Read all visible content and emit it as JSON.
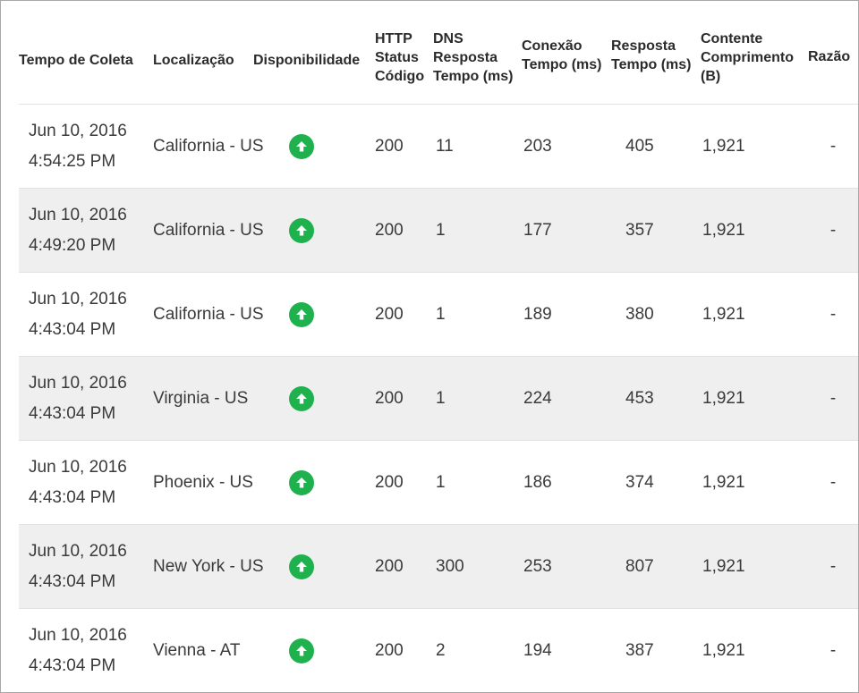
{
  "headers": {
    "collect_time": "Tempo de Coleta",
    "location": "Localização",
    "availability": "Disponibilidade",
    "http_status": [
      "HTTP",
      "Status",
      "Código"
    ],
    "dns_response": [
      "DNS",
      "Resposta",
      "Tempo (ms)"
    ],
    "connection": [
      "Conexão",
      "Tempo (ms)"
    ],
    "response": [
      "Resposta",
      "Tempo (ms)"
    ],
    "content_length": [
      "Contente",
      "Comprimento",
      "(B)"
    ],
    "reason": "Razão"
  },
  "rows": [
    {
      "date": "Jun 10, 2016",
      "time": "4:54:25 PM",
      "location": "California - US",
      "availability_icon": "arrow-up-circle-icon",
      "http": "200",
      "dns": "11",
      "conn": "203",
      "resp": "405",
      "length": "1,921",
      "reason": "-"
    },
    {
      "date": "Jun 10, 2016",
      "time": "4:49:20 PM",
      "location": "California - US",
      "availability_icon": "arrow-up-circle-icon",
      "http": "200",
      "dns": "1",
      "conn": "177",
      "resp": "357",
      "length": "1,921",
      "reason": "-"
    },
    {
      "date": "Jun 10, 2016",
      "time": "4:43:04 PM",
      "location": "California - US",
      "availability_icon": "arrow-up-circle-icon",
      "http": "200",
      "dns": "1",
      "conn": "189",
      "resp": "380",
      "length": "1,921",
      "reason": "-"
    },
    {
      "date": "Jun 10, 2016",
      "time": "4:43:04 PM",
      "location": "Virginia - US",
      "availability_icon": "arrow-up-circle-icon",
      "http": "200",
      "dns": "1",
      "conn": "224",
      "resp": "453",
      "length": "1,921",
      "reason": "-"
    },
    {
      "date": "Jun 10, 2016",
      "time": "4:43:04 PM",
      "location": "Phoenix - US",
      "availability_icon": "arrow-up-circle-icon",
      "http": "200",
      "dns": "1",
      "conn": "186",
      "resp": "374",
      "length": "1,921",
      "reason": "-"
    },
    {
      "date": "Jun 10, 2016",
      "time": "4:43:04 PM",
      "location": "New York - US",
      "availability_icon": "arrow-up-circle-icon",
      "http": "200",
      "dns": "300",
      "conn": "253",
      "resp": "807",
      "length": "1,921",
      "reason": "-"
    },
    {
      "date": "Jun 10, 2016",
      "time": "4:43:04 PM",
      "location": "Vienna - AT",
      "availability_icon": "arrow-up-circle-icon",
      "http": "200",
      "dns": "2",
      "conn": "194",
      "resp": "387",
      "length": "1,921",
      "reason": "-"
    }
  ],
  "colors": {
    "up_icon": "#1fb14d",
    "row_alt_bg": "#efefef",
    "divider": "#e2e2e2"
  }
}
